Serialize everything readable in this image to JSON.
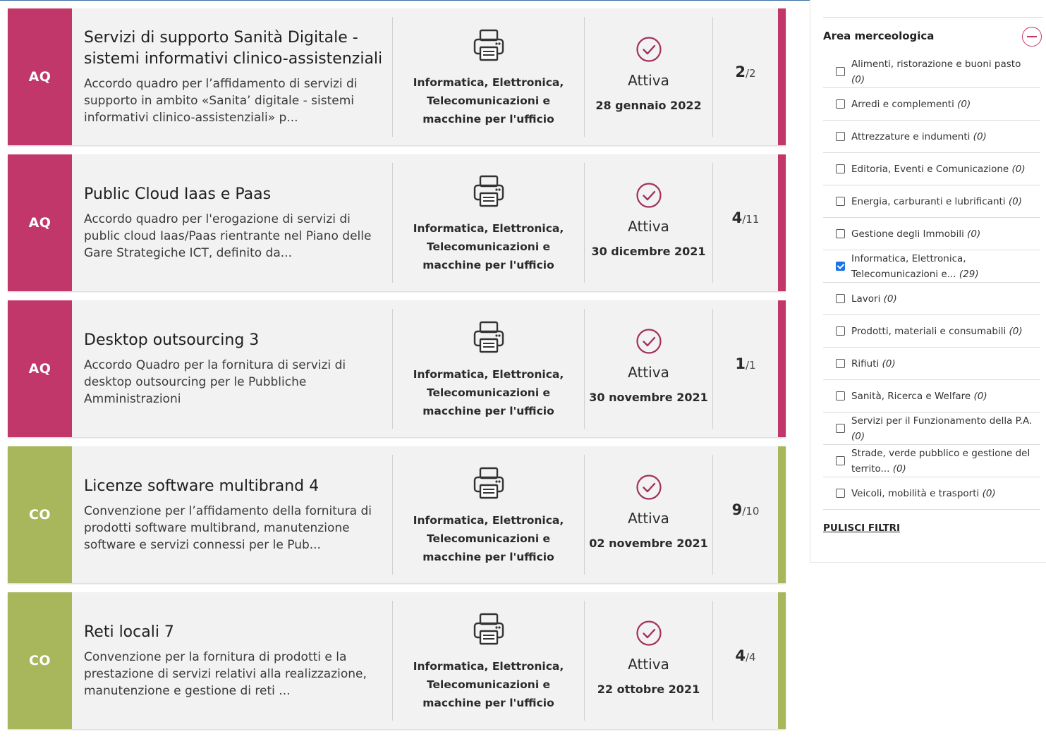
{
  "cards": [
    {
      "tag": "AQ",
      "title": "Servizi di supporto Sanità Digitale - sistemi informativi clinico-assistenziali",
      "description": "Accordo quadro per l’affidamento di servizi di supporto in ambito «Sanita’ digitale - sistemi informativi clinico-assistenziali» p...",
      "category": "Informatica, Elettronica, Telecomunicazioni e macchine per l'ufficio",
      "category_icon": "printer-icon",
      "status": "Attiva",
      "status_icon": "check-circle-icon",
      "date": "28 gennaio 2022",
      "count": "2",
      "total": "/2"
    },
    {
      "tag": "AQ",
      "title": "Public Cloud Iaas e Paas",
      "description": "Accordo quadro per l'erogazione di servizi di public cloud Iaas/Paas rientrante nel Piano delle Gare Strategiche ICT, definito da...",
      "category": "Informatica, Elettronica, Telecomunicazioni e macchine per l'ufficio",
      "category_icon": "printer-icon",
      "status": "Attiva",
      "status_icon": "check-circle-icon",
      "date": "30 dicembre 2021",
      "count": "4",
      "total": "/11"
    },
    {
      "tag": "AQ",
      "title": "Desktop outsourcing 3",
      "description": "Accordo Quadro per la fornitura di servizi di desktop outsourcing per le Pubbliche Amministrazioni",
      "category": "Informatica, Elettronica, Telecomunicazioni e macchine per l'ufficio",
      "category_icon": "printer-icon",
      "status": "Attiva",
      "status_icon": "check-circle-icon",
      "date": "30 novembre 2021",
      "count": "1",
      "total": "/1"
    },
    {
      "tag": "CO",
      "title": "Licenze software multibrand 4",
      "description": "Convenzione per l’affidamento della fornitura di prodotti software multibrand, manutenzione software e servizi connessi per le Pub...",
      "category": "Informatica, Elettronica, Telecomunicazioni e macchine per l'ufficio",
      "category_icon": "printer-icon",
      "status": "Attiva",
      "status_icon": "check-circle-icon",
      "date": "02 novembre 2021",
      "count": "9",
      "total": "/10"
    },
    {
      "tag": "CO",
      "title": "Reti locali 7",
      "description": "Convenzione per la fornitura di prodotti e la prestazione di servizi relativi alla realizzazione, manutenzione e gestione di reti ...",
      "category": "Informatica, Elettronica, Telecomunicazioni e macchine per l'ufficio",
      "category_icon": "printer-icon",
      "status": "Attiva",
      "status_icon": "check-circle-icon",
      "date": "22 ottobre 2021",
      "count": "4",
      "total": "/4"
    }
  ],
  "colors": {
    "AQ": "#c2376a",
    "CO": "#a9b75c",
    "check_icon": "#a3305e"
  },
  "sidebar": {
    "section_title": "Area merceologica",
    "collapse_icon": "minus-circle-icon",
    "filters": [
      {
        "label": "Alimenti, ristorazione e buoni pasto",
        "count": "(0)",
        "checked": false
      },
      {
        "label": "Arredi e complementi",
        "count": "(0)",
        "checked": false
      },
      {
        "label": "Attrezzature e indumenti",
        "count": "(0)",
        "checked": false
      },
      {
        "label": "Editoria, Eventi e Comunicazione",
        "count": "(0)",
        "checked": false
      },
      {
        "label": "Energia, carburanti e lubrificanti",
        "count": "(0)",
        "checked": false
      },
      {
        "label": "Gestione degli Immobili",
        "count": "(0)",
        "checked": false
      },
      {
        "label": "Informatica, Elettronica, Telecomunicazioni e...",
        "count": "(29)",
        "checked": true
      },
      {
        "label": "Lavori",
        "count": "(0)",
        "checked": false
      },
      {
        "label": "Prodotti, materiali e consumabili",
        "count": "(0)",
        "checked": false
      },
      {
        "label": "Rifiuti",
        "count": "(0)",
        "checked": false
      },
      {
        "label": "Sanità, Ricerca e Welfare",
        "count": "(0)",
        "checked": false
      },
      {
        "label": "Servizi per il Funzionamento della P.A.",
        "count": "(0)",
        "checked": false
      },
      {
        "label": "Strade, verde pubblico e gestione del territo...",
        "count": "(0)",
        "checked": false
      },
      {
        "label": "Veicoli, mobilità e trasporti",
        "count": "(0)",
        "checked": false
      }
    ],
    "clear_filters": "PULISCI FILTRI"
  }
}
